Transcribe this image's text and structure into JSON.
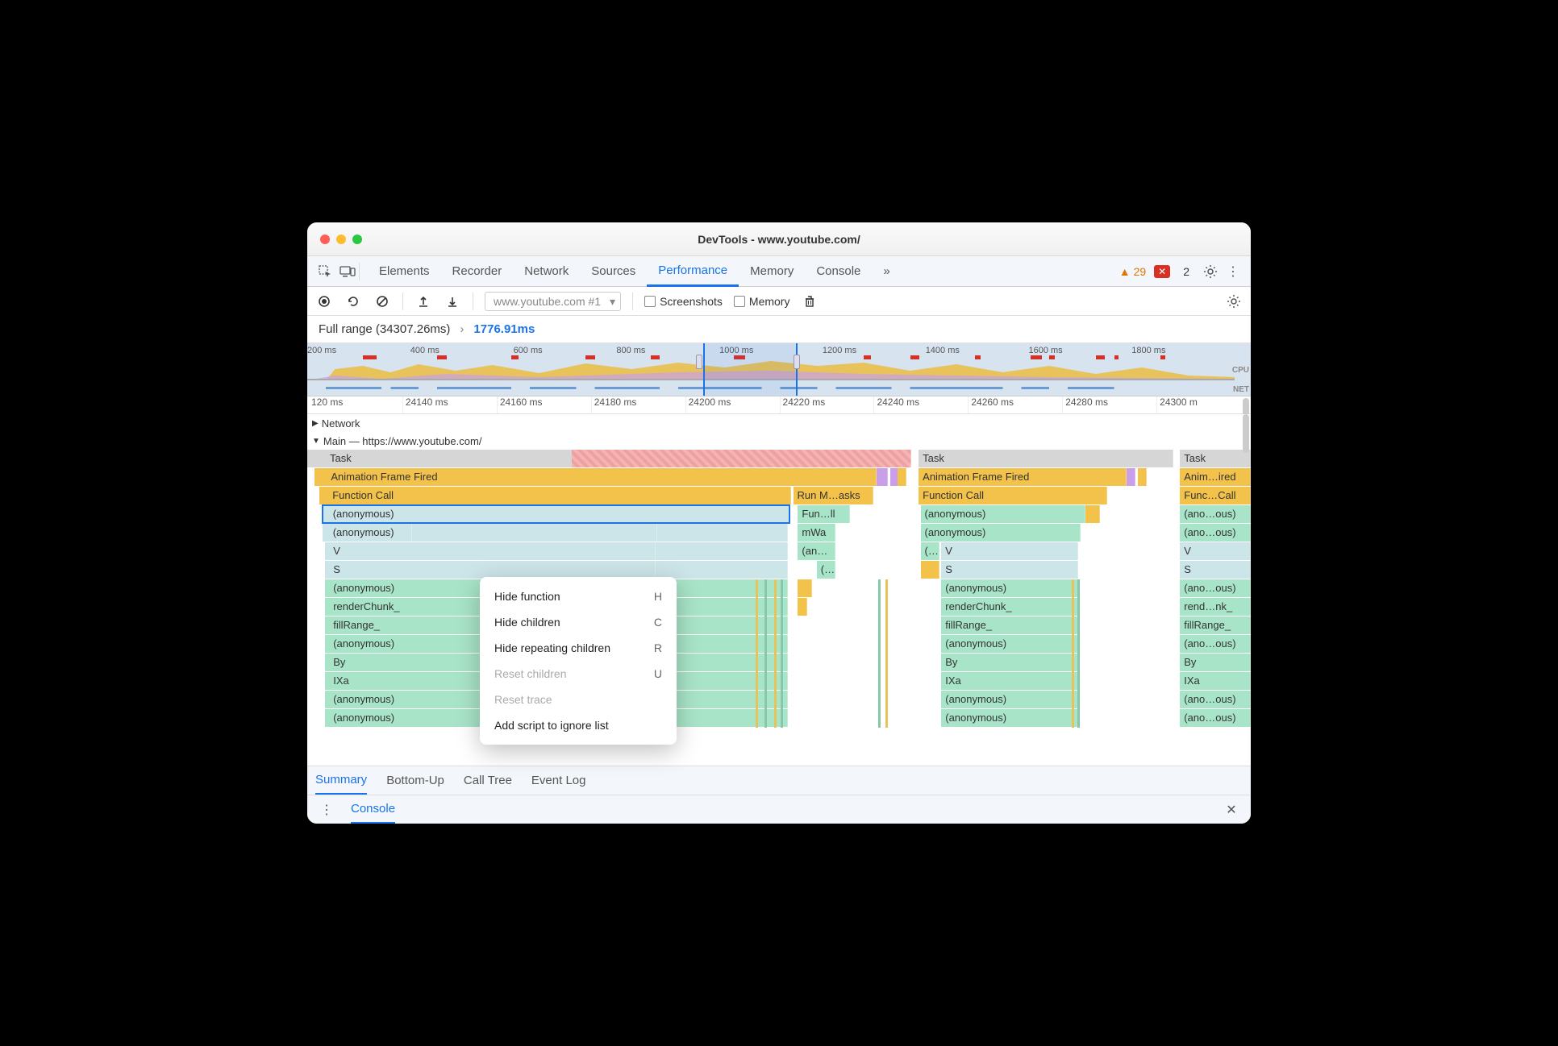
{
  "window": {
    "title": "DevTools - www.youtube.com/"
  },
  "tabs": {
    "items": [
      "Elements",
      "Recorder",
      "Network",
      "Sources",
      "Performance",
      "Memory",
      "Console"
    ],
    "active": "Performance"
  },
  "badges": {
    "warnings": "29",
    "errors": "2"
  },
  "toolbar": {
    "recording_select": "www.youtube.com #1",
    "screenshots_label": "Screenshots",
    "memory_label": "Memory"
  },
  "breadcrumb": {
    "full": "Full range (34307.26ms)",
    "chevron": "›",
    "selection": "1776.91ms"
  },
  "overview": {
    "ticks": [
      "200 ms",
      "400 ms",
      "600 ms",
      "800 ms",
      "1000 ms",
      "1200 ms",
      "1400 ms",
      "1600 ms",
      "1800 ms"
    ],
    "labels": {
      "cpu": "CPU",
      "net": "NET"
    }
  },
  "ruler": {
    "ticks": [
      "120 ms",
      "24140 ms",
      "24160 ms",
      "24180 ms",
      "24200 ms",
      "24220 ms",
      "24240 ms",
      "24260 ms",
      "24280 ms",
      "24300 m"
    ]
  },
  "sections": {
    "network": "Network",
    "main": "Main — https://www.youtube.com/"
  },
  "flame": {
    "col1": {
      "task": "Task",
      "anim": "Animation Frame Fired",
      "func": "Function Call",
      "runm": "Run M…asks",
      "anon1": "(anonymous)",
      "funll": "Fun…ll",
      "anon2": "(anonymous)",
      "mwa": "mWa",
      "v": "V",
      "ans": "(an…s)",
      "s": "S",
      "paren": "(…",
      "anon3": "(anonymous)",
      "render": "renderChunk_",
      "fill": "fillRange_",
      "anon4": "(anonymous)",
      "by": "By",
      "ixa": "IXa",
      "anon5": "(anonymous)",
      "anon6": "(anonymous)"
    },
    "col2": {
      "task": "Task",
      "anim": "Animation Frame Fired",
      "func": "Function Call",
      "anon1": "(anonymous)",
      "anon2": "(anonymous)",
      "paren": "(…",
      "v": "V",
      "s": "S",
      "anon3": "(anonymous)",
      "render": "renderChunk_",
      "fill": "fillRange_",
      "anon4": "(anonymous)",
      "by": "By",
      "ixa": "IXa",
      "anon5": "(anonymous)",
      "anon6": "(anonymous)"
    },
    "col3": {
      "task": "Task",
      "anim": "Anim…ired",
      "func": "Func…Call",
      "anon1": "(ano…ous)",
      "anon2": "(ano…ous)",
      "v": "V",
      "s": "S",
      "anon3": "(ano…ous)",
      "render": "rend…nk_",
      "fill": "fillRange_",
      "anon4": "(ano…ous)",
      "by": "By",
      "ixa": "IXa",
      "anon5": "(ano…ous)",
      "anon6": "(ano…ous)"
    }
  },
  "context_menu": {
    "items": [
      {
        "label": "Hide function",
        "key": "H",
        "disabled": false
      },
      {
        "label": "Hide children",
        "key": "C",
        "disabled": false
      },
      {
        "label": "Hide repeating children",
        "key": "R",
        "disabled": false
      },
      {
        "label": "Reset children",
        "key": "U",
        "disabled": true
      },
      {
        "label": "Reset trace",
        "key": "",
        "disabled": true
      },
      {
        "label": "Add script to ignore list",
        "key": "",
        "disabled": false
      }
    ]
  },
  "bottom_tabs": {
    "items": [
      "Summary",
      "Bottom-Up",
      "Call Tree",
      "Event Log"
    ],
    "active": "Summary"
  },
  "console": {
    "label": "Console"
  }
}
